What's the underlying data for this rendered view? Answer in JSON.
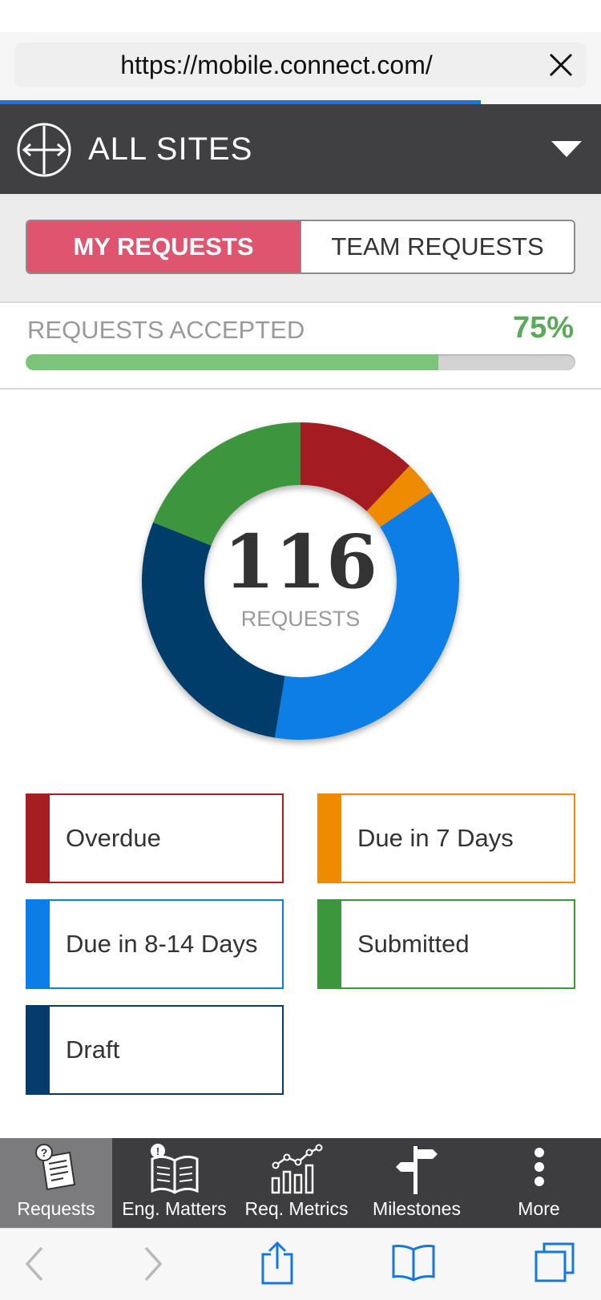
{
  "browser": {
    "url": "https://mobile.connect.com/",
    "load_progress_percent": 80
  },
  "site_selector": {
    "title": "ALL SITES"
  },
  "segment": {
    "active_label": "MY REQUESTS",
    "inactive_label": "TEAM REQUESTS"
  },
  "accepted": {
    "label": "REQUESTS ACCEPTED",
    "percent_text": "75%",
    "percent_value": 75
  },
  "donut": {
    "count": "116",
    "caption": "REQUESTS",
    "segments": [
      {
        "name": "Overdue",
        "value": 14,
        "color": "#a41e22"
      },
      {
        "name": "Due in 7 Days",
        "value": 4,
        "color": "#ee8b00"
      },
      {
        "name": "Due in 8-14 Days",
        "value": 43,
        "color": "#0a7ee6"
      },
      {
        "name": "Draft",
        "value": 33,
        "color": "#053c6b"
      },
      {
        "name": "Submitted",
        "value": 22,
        "color": "#3c963c"
      }
    ]
  },
  "legend": {
    "items": [
      {
        "label": "Overdue",
        "color": "#a41e22"
      },
      {
        "label": "Due in 7 Days",
        "color": "#ee8b00"
      },
      {
        "label": "Due in 8-14 Days",
        "color": "#0a7ee6"
      },
      {
        "label": "Submitted",
        "color": "#3c963c"
      },
      {
        "label": "Draft",
        "color": "#053c6b"
      }
    ]
  },
  "tabs": [
    {
      "label": "Requests",
      "icon": "requests-icon",
      "active": true
    },
    {
      "label": "Eng. Matters",
      "icon": "book-icon",
      "active": false
    },
    {
      "label": "Req. Metrics",
      "icon": "metrics-icon",
      "active": false
    },
    {
      "label": "Milestones",
      "icon": "signpost-icon",
      "active": false
    },
    {
      "label": "More",
      "icon": "more-icon",
      "active": false
    }
  ],
  "toolbar": {
    "icons": [
      "back-icon",
      "forward-icon",
      "share-icon",
      "bookmarks-icon",
      "tabs-icon"
    ]
  }
}
